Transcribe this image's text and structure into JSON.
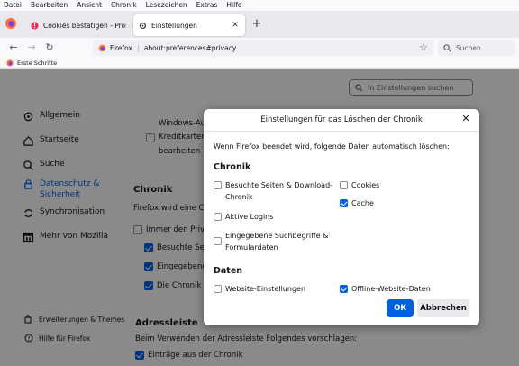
{
  "menubar": [
    "Datei",
    "Bearbeiten",
    "Ansicht",
    "Chronik",
    "Lesezeichen",
    "Extras",
    "Hilfe"
  ],
  "tabs": [
    {
      "title": "Cookies bestätigen - Probleme auf"
    },
    {
      "title": "Einstellungen"
    }
  ],
  "urlbar": {
    "identity": "Firefox",
    "url": "about:preferences#privacy"
  },
  "searchbar": {
    "placeholder": "Suchen"
  },
  "bookmarks": {
    "first": "Erste Schritte"
  },
  "prefs": {
    "search_placeholder": "In Einstellungen suchen",
    "sidebar": [
      "Allgemein",
      "Startseite",
      "Suche",
      "Datenschutz &",
      "Sicherheit",
      "Synchronisation",
      "Mehr von Mozilla"
    ],
    "footer": [
      "Erweiterungen & Themes",
      "Hilfe für Firefox"
    ],
    "content": {
      "windows_auth": "Windows-Auth",
      "kreditkarten": "Kreditkarten a",
      "bearbeiten": "bearbeiten",
      "chronik_h": "Chronik",
      "firefox_wird": "Firefox wird eine Chro",
      "immer": "Immer den Private",
      "besuchte": "Besuchte Seite",
      "eingegebene": "Eingegebene S",
      "die_chronik": "Die Chronik lö",
      "adressleiste_h": "Adressleiste",
      "adressleiste_txt": "Beim Verwenden der Adressleiste Folgendes vorschlagen:",
      "eintraege": "Einträge aus der Chronik"
    }
  },
  "dialog": {
    "title": "Einstellungen für das Löschen der Chronik",
    "intro": "Wenn Firefox beendet wird, folgende Daten automatisch löschen:",
    "chronik_heading": "Chronik",
    "options": {
      "besuchte_1": "Besuchte Seiten & Download-",
      "besuchte_2": "Chronik",
      "logins": "Aktive Logins",
      "suchbegriffe_1": "Eingegebene Suchbegriffe &",
      "suchbegriffe_2": "Formulardaten",
      "cookies": "Cookies",
      "cache": "Cache",
      "website_einstellungen": "Website-Einstellungen",
      "offline": "Offline-Website-Daten"
    },
    "daten_heading": "Daten",
    "ok": "OK",
    "cancel": "Abbrechen"
  },
  "colors": {
    "accent": "#0061e0",
    "firefox_orange": "#ff7139"
  }
}
